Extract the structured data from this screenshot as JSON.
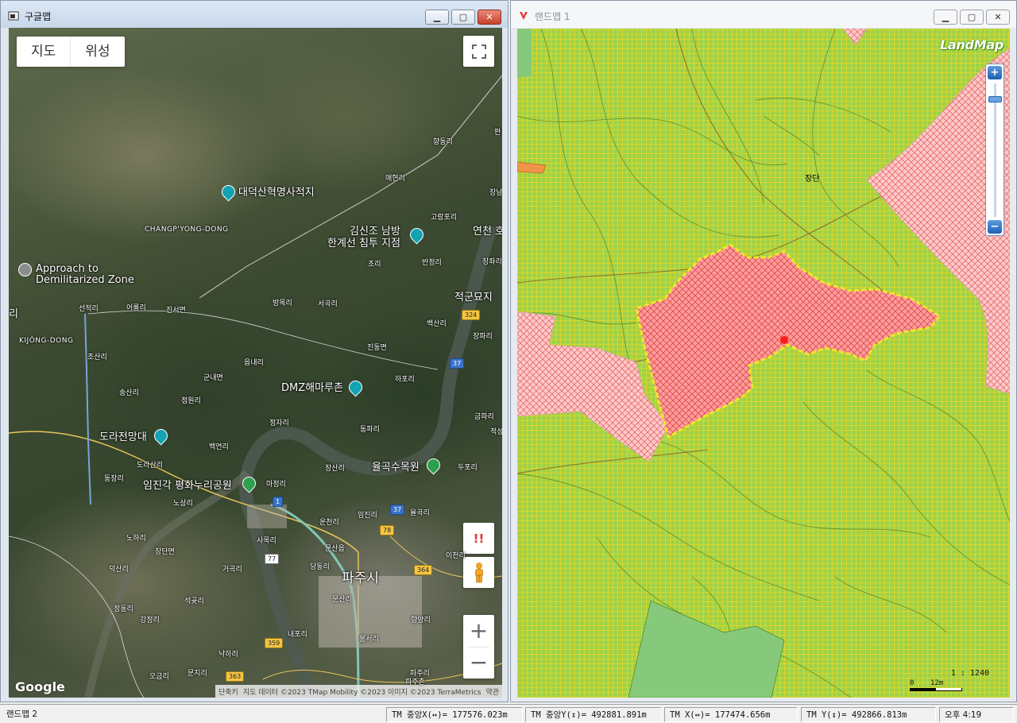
{
  "left_window": {
    "title": "구글맵",
    "map_type": {
      "map": "지도",
      "satellite": "위성"
    },
    "google_logo": "Google",
    "warning_label": "!!",
    "zoom_in": "+",
    "zoom_out": "−",
    "attribution": {
      "shortcuts": "단축키",
      "map_data": "지도 데이터 ©2023 TMap Mobility ©2023 이미지 ©2023 TerraMetrics",
      "terms": "약관"
    },
    "places": {
      "hyangdong": "향동리",
      "maehyeon": "매현리",
      "daedeoksan": "대덕산혁명사적지",
      "changpyong": "CHANGP'YONG-DONG",
      "jangnam": "장남",
      "gorangpo": "고랑포리",
      "kimsinjo": "김신조 남방",
      "hangyeseon": "한계선 침투 지점",
      "yeoncheon": "연천 호",
      "approach1": "Approach to",
      "approach2": "Demilitarized Zone",
      "banjeong": "반정리",
      "jangjwa": "장좌리",
      "chori": "초리",
      "jeokgun": "적군묘지",
      "ri": "리",
      "seonjeok": "선적리",
      "eoryong": "어룡리",
      "jinseo": "진서면",
      "bangmok": "방목리",
      "seogok": "서곡리",
      "kijong": "KIJŎNG-DONG",
      "baeksan": "백산리",
      "jangpa": "장파리",
      "jindong": "진동면",
      "josan": "조산리",
      "eumna": "읍내리",
      "gunnae": "군내면",
      "hapo": "하포리",
      "dmz_hamaru": "DMZ해마루촌",
      "songsan": "송산리",
      "jeomwon": "점원리",
      "jeongja": "정자리",
      "geumpa": "금파리",
      "dorasan_obs": "도라전망대",
      "dongpa": "동파리",
      "jeokseong": "적성",
      "baegyeon": "백연리",
      "dorasan": "도라산리",
      "dongjang": "동장리",
      "jangsan": "장산리",
      "yulgok_arbor": "율곡수목원",
      "dupo": "두포리",
      "imjingak": "임진각 평화누리공원",
      "majeong": "마정리",
      "nosang": "노상리",
      "imjin": "임진리",
      "yulgok": "율곡리",
      "uncheon": "운천리",
      "nohari": "노하리",
      "sanok": "사목리",
      "munsaneup": "문산읍",
      "jangdan": "장단면",
      "idong": "이천리",
      "deoksan": "덕산리",
      "geogok": "거곡리",
      "dangdong": "당동리",
      "pajusi": "파주시",
      "seokgot": "석곶리",
      "munsan": "문산리",
      "jeongdong": "정동리",
      "gangjeong": "강정리",
      "hyangyang": "향양리",
      "naepo": "내포리",
      "bongseo": "봉서리",
      "nakha": "낙하리",
      "ogeum": "오금리",
      "munji": "문지리",
      "paju": "파주리",
      "pajuchon": "파주촌",
      "pan": "판"
    },
    "routes": {
      "r324": "324",
      "r37": "37",
      "r37b": "37",
      "r1": "1",
      "r78": "78",
      "r77": "77",
      "r364": "364",
      "r359": "359",
      "r363": "363"
    }
  },
  "right_window": {
    "title": "랜드맵 1",
    "logo": "LandMap",
    "place_label": "장단",
    "zoom_in": "+",
    "zoom_out": "−",
    "scale_ratio": "1 : 1240",
    "scale_zero": "0",
    "scale_len": "12m"
  },
  "status_bar": {
    "app_name": "랜드맵 2",
    "tm_center_x": "TM 중앙X(↔)= 177576.023m",
    "tm_center_y": "TM 중앙Y(↕)= 492881.891m",
    "tm_x": "TM X(↔)= 177474.656m",
    "tm_y": "TM Y(↕)= 492866.813m",
    "time": "오후 4:19"
  }
}
